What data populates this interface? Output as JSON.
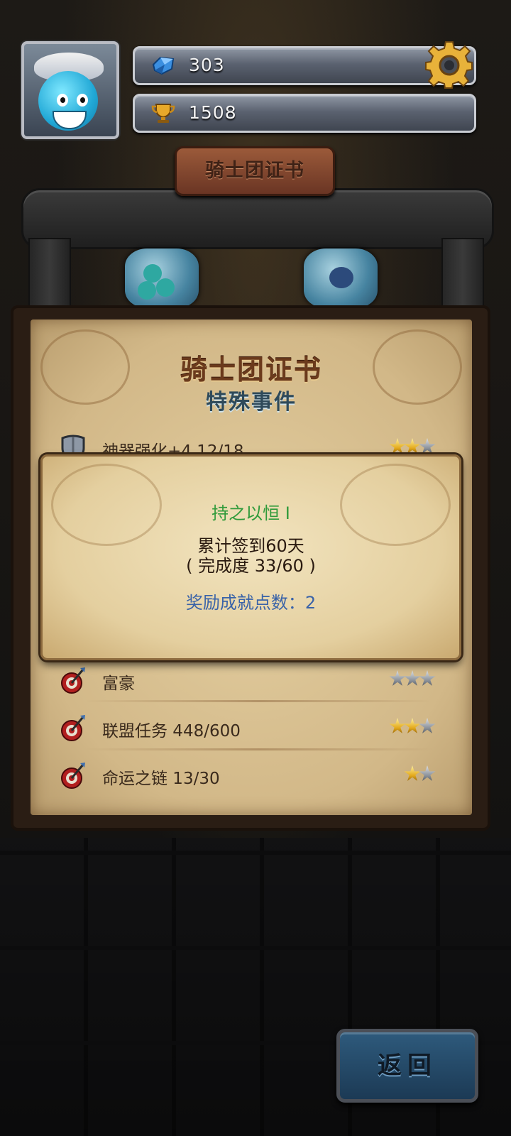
{
  "header": {
    "gems": "303",
    "trophies": "1508",
    "gem_icon": "blue-gem-icon",
    "trophy_icon": "gold-trophy-icon",
    "settings_icon": "gear-icon"
  },
  "banner": {
    "sign_text": "骑士团证书"
  },
  "certificate": {
    "title": "骑士团证书",
    "subtitle": "特殊事件",
    "rows": [
      {
        "label": "神器强化+4 12/18",
        "icon": "shield-icon",
        "stars_gold": 2,
        "stars_total": 3
      },
      {
        "label": "富豪",
        "icon": "target-arrow-icon",
        "stars_gold": 0,
        "stars_total": 3
      },
      {
        "label": "联盟任务 448/600",
        "icon": "target-arrow-icon",
        "stars_gold": 2,
        "stars_total": 3
      },
      {
        "label": "命运之链 13/30",
        "icon": "target-arrow-icon",
        "stars_gold": 1,
        "stars_total": 2
      }
    ]
  },
  "popup": {
    "title": "持之以恒 I",
    "desc_line1": "累计签到60天",
    "desc_line2": "( 完成度 33/60 )",
    "reward": "奖励成就点数：2"
  },
  "back_button": {
    "label": "返回"
  },
  "colors": {
    "popup_title": "#2f9a3a",
    "popup_reward": "#3a63a8",
    "title_brown": "#6b3a1c"
  }
}
